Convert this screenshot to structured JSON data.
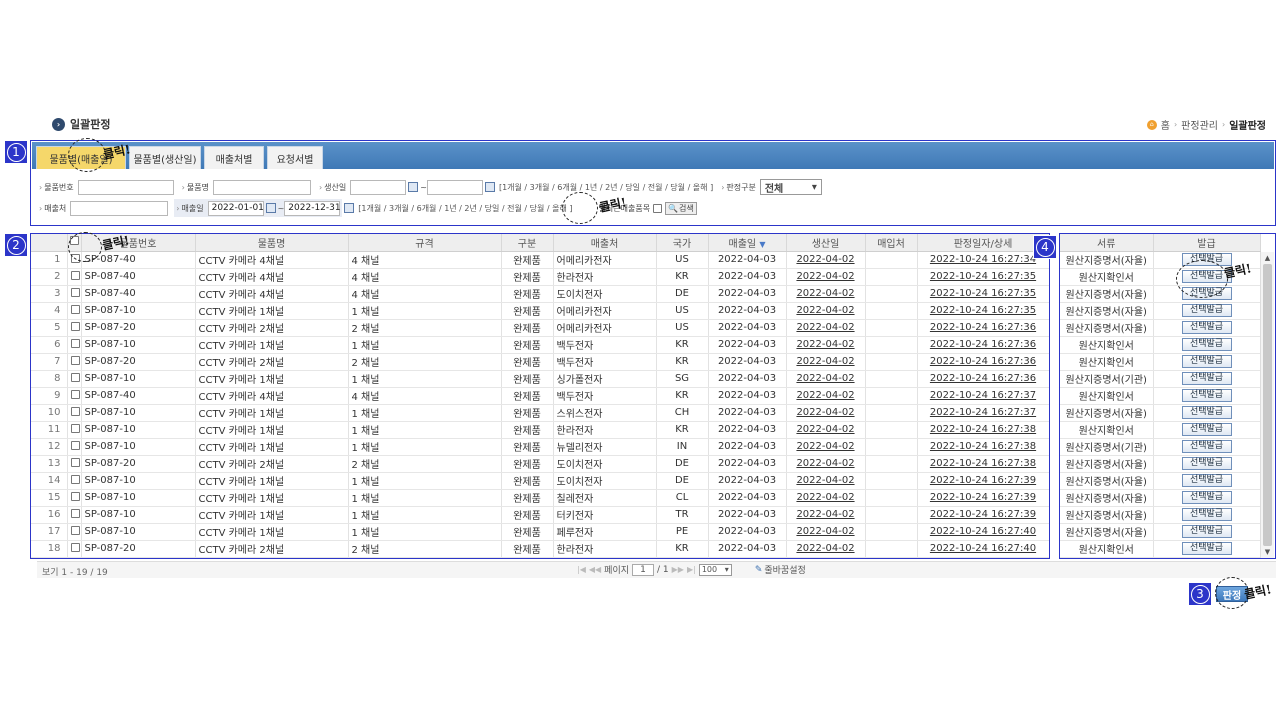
{
  "page": {
    "title": "일괄판정"
  },
  "breadcrumb": {
    "home": "홈",
    "parent": "판정관리",
    "current": "일괄판정"
  },
  "badges": [
    "1",
    "2",
    "3",
    "4"
  ],
  "click_note": "클릭!",
  "tabs": [
    "물품별(매출일)",
    "물품별(생산일)",
    "매출처별",
    "요청서별"
  ],
  "filters": {
    "item_no_label": "물품번호",
    "item_name_label": "물품명",
    "prod_date_label": "생산일",
    "tilde": "~",
    "period_links": "[1개월 / 3개월 / 6개월 / 1년 / 2년 / 당일 / 전월 / 당월 / 올해 ]",
    "judge_type_label": "판정구분",
    "judge_type_value": "전체",
    "customer_label": "매출처",
    "sales_date_label": "매출일",
    "sales_date_from": "2022-01-01",
    "sales_date_to": "2022-12-31",
    "recent_label": "별최근매출품목",
    "search_label": "검색"
  },
  "grid": {
    "columns": [
      "물품번호",
      "물품명",
      "규격",
      "구분",
      "매출처",
      "국가",
      "매출일",
      "생산일",
      "매입처",
      "판정일자/상세"
    ],
    "sort_indicator": "▼",
    "rows": [
      [
        "1",
        "SP-087-40",
        "CCTV 카메라 4채널",
        "4 채널",
        "완제품",
        "어메리카전자",
        "US",
        "2022-04-03",
        "2022-04-02",
        "",
        "2022-10-24 16:27:34"
      ],
      [
        "2",
        "SP-087-40",
        "CCTV 카메라 4채널",
        "4 채널",
        "완제품",
        "한라전자",
        "KR",
        "2022-04-03",
        "2022-04-02",
        "",
        "2022-10-24 16:27:35"
      ],
      [
        "3",
        "SP-087-40",
        "CCTV 카메라 4채널",
        "4 채널",
        "완제품",
        "도이치전자",
        "DE",
        "2022-04-03",
        "2022-04-02",
        "",
        "2022-10-24 16:27:35"
      ],
      [
        "4",
        "SP-087-10",
        "CCTV 카메라 1채널",
        "1 채널",
        "완제품",
        "어메리카전자",
        "US",
        "2022-04-03",
        "2022-04-02",
        "",
        "2022-10-24 16:27:35"
      ],
      [
        "5",
        "SP-087-20",
        "CCTV 카메라 2채널",
        "2 채널",
        "완제품",
        "어메리카전자",
        "US",
        "2022-04-03",
        "2022-04-02",
        "",
        "2022-10-24 16:27:36"
      ],
      [
        "6",
        "SP-087-10",
        "CCTV 카메라 1채널",
        "1 채널",
        "완제품",
        "백두전자",
        "KR",
        "2022-04-03",
        "2022-04-02",
        "",
        "2022-10-24 16:27:36"
      ],
      [
        "7",
        "SP-087-20",
        "CCTV 카메라 2채널",
        "2 채널",
        "완제품",
        "백두전자",
        "KR",
        "2022-04-03",
        "2022-04-02",
        "",
        "2022-10-24 16:27:36"
      ],
      [
        "8",
        "SP-087-10",
        "CCTV 카메라 1채널",
        "1 채널",
        "완제품",
        "싱가폴전자",
        "SG",
        "2022-04-03",
        "2022-04-02",
        "",
        "2022-10-24 16:27:36"
      ],
      [
        "9",
        "SP-087-40",
        "CCTV 카메라 4채널",
        "4 채널",
        "완제품",
        "백두전자",
        "KR",
        "2022-04-03",
        "2022-04-02",
        "",
        "2022-10-24 16:27:37"
      ],
      [
        "10",
        "SP-087-10",
        "CCTV 카메라 1채널",
        "1 채널",
        "완제품",
        "스위스전자",
        "CH",
        "2022-04-03",
        "2022-04-02",
        "",
        "2022-10-24 16:27:37"
      ],
      [
        "11",
        "SP-087-10",
        "CCTV 카메라 1채널",
        "1 채널",
        "완제품",
        "한라전자",
        "KR",
        "2022-04-03",
        "2022-04-02",
        "",
        "2022-10-24 16:27:38"
      ],
      [
        "12",
        "SP-087-10",
        "CCTV 카메라 1채널",
        "1 채널",
        "완제품",
        "뉴델리전자",
        "IN",
        "2022-04-03",
        "2022-04-02",
        "",
        "2022-10-24 16:27:38"
      ],
      [
        "13",
        "SP-087-20",
        "CCTV 카메라 2채널",
        "2 채널",
        "완제품",
        "도이치전자",
        "DE",
        "2022-04-03",
        "2022-04-02",
        "",
        "2022-10-24 16:27:38"
      ],
      [
        "14",
        "SP-087-10",
        "CCTV 카메라 1채널",
        "1 채널",
        "완제품",
        "도이치전자",
        "DE",
        "2022-04-03",
        "2022-04-02",
        "",
        "2022-10-24 16:27:39"
      ],
      [
        "15",
        "SP-087-10",
        "CCTV 카메라 1채널",
        "1 채널",
        "완제품",
        "칠레전자",
        "CL",
        "2022-04-03",
        "2022-04-02",
        "",
        "2022-10-24 16:27:39"
      ],
      [
        "16",
        "SP-087-10",
        "CCTV 카메라 1채널",
        "1 채널",
        "완제품",
        "터키전자",
        "TR",
        "2022-04-03",
        "2022-04-02",
        "",
        "2022-10-24 16:27:39"
      ],
      [
        "17",
        "SP-087-10",
        "CCTV 카메라 1채널",
        "1 채널",
        "완제품",
        "페루전자",
        "PE",
        "2022-04-03",
        "2022-04-02",
        "",
        "2022-10-24 16:27:40"
      ],
      [
        "18",
        "SP-087-20",
        "CCTV 카메라 2채널",
        "2 채널",
        "완제품",
        "한라전자",
        "KR",
        "2022-04-03",
        "2022-04-02",
        "",
        "2022-10-24 16:27:40"
      ]
    ]
  },
  "docs": {
    "columns": [
      "서류",
      "발급"
    ],
    "issue_label": "선택발급",
    "rows": [
      "원산지증명서(자율)",
      "원산지확인서",
      "원산지증명서(자율)",
      "원산지증명서(자율)",
      "원산지증명서(자율)",
      "원산지확인서",
      "원산지확인서",
      "원산지증명서(기관)",
      "원산지확인서",
      "원산지증명서(자율)",
      "원산지확인서",
      "원산지증명서(기관)",
      "원산지증명서(자율)",
      "원산지증명서(자율)",
      "원산지증명서(자율)",
      "원산지증명서(자율)",
      "원산지증명서(자율)",
      "원산지확인서"
    ]
  },
  "footer": {
    "view_count": "보기 1 - 19 / 19",
    "page_label": "페이지",
    "page_current": "1",
    "page_total": "/ 1",
    "page_size": "100",
    "column_setting": "줄바꿈설정"
  },
  "judge_button": "판정"
}
